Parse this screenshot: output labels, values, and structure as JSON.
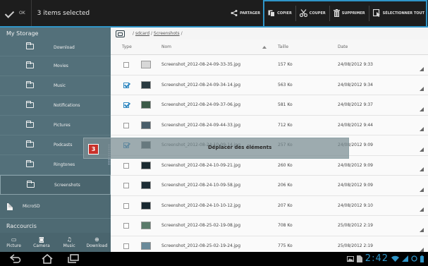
{
  "actionbar": {
    "ok_label": "OK",
    "title": "3 items selected",
    "actions": [
      {
        "label": "PARTAGER",
        "icon": "share-icon"
      },
      {
        "label": "COPIER",
        "icon": "copy-icon"
      },
      {
        "label": "COUPER",
        "icon": "cut-icon"
      },
      {
        "label": "SUPPRIMER",
        "icon": "trash-icon"
      },
      {
        "label": "SÉLECTIONNER TOUT",
        "icon": "select-all-icon"
      }
    ]
  },
  "sidebar": {
    "header": "My Storage",
    "folders": [
      {
        "label": "Download",
        "icon": "folder-icon"
      },
      {
        "label": "Movies",
        "icon": "folder-icon"
      },
      {
        "label": "Music",
        "icon": "folder-icon"
      },
      {
        "label": "Notifications",
        "icon": "folder-icon"
      },
      {
        "label": "Pictures",
        "icon": "folder-icon"
      },
      {
        "label": "Podcasts",
        "icon": "folder-icon"
      },
      {
        "label": "Ringtones",
        "icon": "folder-icon"
      },
      {
        "label": "Screenshots",
        "icon": "folder-icon",
        "selected": true
      }
    ],
    "microsd": "MicroSD",
    "raccourcis": "Raccourcis",
    "shortcuts": [
      {
        "label": "Picture",
        "icon": "picture-icon"
      },
      {
        "label": "Camera",
        "icon": "camera-icon"
      },
      {
        "label": "Music",
        "icon": "music-icon"
      },
      {
        "label": "Download",
        "icon": "download-icon"
      }
    ]
  },
  "pathbar": {
    "sep": "/",
    "seg1": "sdcard",
    "seg2": "Screenshots",
    "trail": "/"
  },
  "table": {
    "headers": {
      "type": "Type",
      "name": "Nom",
      "size": "Taille",
      "date": "Date"
    },
    "rows": [
      {
        "checked": false,
        "name": "Screenshot_2012-08-24-09-33-35.jpg",
        "size": "157 Ko",
        "date": "24/08/2012 9:33"
      },
      {
        "checked": true,
        "name": "Screenshot_2012-08-24-09-34-14.jpg",
        "size": "563 Ko",
        "date": "24/08/2012 9:34"
      },
      {
        "checked": true,
        "name": "Screenshot_2012-08-24-09-37-06.jpg",
        "size": "581 Ko",
        "date": "24/08/2012 9:37"
      },
      {
        "checked": false,
        "name": "Screenshot_2012-08-24-09-44-33.jpg",
        "size": "712 Ko",
        "date": "24/08/2012 9:44"
      },
      {
        "checked": true,
        "name": "Screenshot_2012-08-24-10-09-14.jpg",
        "size": "257 Ko",
        "date": "24/08/2012 9:09"
      },
      {
        "checked": false,
        "name": "Screenshot_2012-08-24-10-09-21.jpg",
        "size": "260 Ko",
        "date": "24/08/2012 9:09"
      },
      {
        "checked": false,
        "name": "Screenshot_2012-08-24-10-09-58.jpg",
        "size": "206 Ko",
        "date": "24/08/2012 9:09"
      },
      {
        "checked": false,
        "name": "Screenshot_2012-08-24-10-10-12.jpg",
        "size": "207 Ko",
        "date": "24/08/2012 9:10"
      },
      {
        "checked": false,
        "name": "Screenshot_2012-08-25-02-19-08.jpg",
        "size": "708 Ko",
        "date": "25/08/2012 2:19"
      },
      {
        "checked": false,
        "name": "Screenshot_2012-08-25-02-19-24.jpg",
        "size": "775 Ko",
        "date": "25/08/2012 2:19"
      }
    ]
  },
  "drag": {
    "count": "3",
    "hint": "Déplacer des éléments"
  },
  "statusbar": {
    "clock": "2:42"
  },
  "colors": {
    "accent": "#2f95c8",
    "sidebar": "#53707a",
    "badge": "#c8302a"
  }
}
